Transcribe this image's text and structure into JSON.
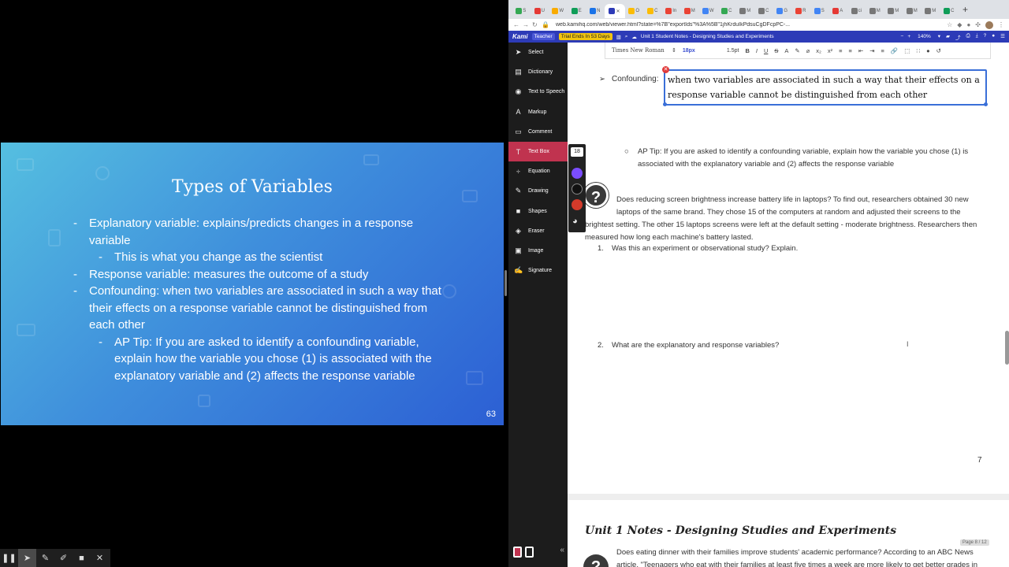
{
  "slide": {
    "title": "Types of Variables",
    "bullets": [
      {
        "level": 1,
        "text": "Explanatory variable: explains/predicts changes in a response variable"
      },
      {
        "level": 2,
        "text": "This is what you change as the scientist"
      },
      {
        "level": 1,
        "text": "Response variable: measures the outcome of a study"
      },
      {
        "level": 1,
        "text": "Confounding: when two variables are associated in such a way that their effects on a response variable cannot be distinguished from each other"
      },
      {
        "level": 2,
        "text": "AP Tip: If you are asked to identify a confounding variable, explain how the variable you chose (1) is associated with the explanatory variable and (2) affects the response variable"
      }
    ],
    "number": "63"
  },
  "browser": {
    "tabs": [
      "S",
      "U",
      "W",
      "E",
      "N",
      "",
      "O",
      "C",
      "In",
      "M",
      "W",
      "C",
      "M",
      "C",
      "G",
      "R",
      "S",
      "A",
      "ci",
      "M",
      "M",
      "M",
      "M",
      "C"
    ],
    "url": "web.kamihq.com/web/viewer.html?state=%7B\"exportIds\"%3A%5B\"1jhKrduIkPdsuCgDFcpPC-...",
    "kami": {
      "logo": "Kami",
      "teacher": "Teacher",
      "trial": "Trial Ends In 53 Days",
      "doc_title": "Unit 1 Student Notes - Designing Studies and Experiments",
      "zoom": "140%"
    }
  },
  "tools": [
    {
      "label": "Select",
      "icon": "cursor-icon",
      "glyph": "➤"
    },
    {
      "label": "Dictionary",
      "icon": "dictionary-icon",
      "glyph": "▤"
    },
    {
      "label": "Text to Speech",
      "icon": "speech-icon",
      "glyph": "◉"
    },
    {
      "label": "Markup",
      "icon": "markup-icon",
      "glyph": "A"
    },
    {
      "label": "Comment",
      "icon": "comment-icon",
      "glyph": "▭"
    },
    {
      "label": "Text Box",
      "icon": "textbox-icon",
      "glyph": "T"
    },
    {
      "label": "Equation",
      "icon": "equation-icon",
      "glyph": "÷"
    },
    {
      "label": "Drawing",
      "icon": "drawing-icon",
      "glyph": "✎"
    },
    {
      "label": "Shapes",
      "icon": "shapes-icon",
      "glyph": "■"
    },
    {
      "label": "Eraser",
      "icon": "eraser-icon",
      "glyph": "◈"
    },
    {
      "label": "Image",
      "icon": "image-icon",
      "glyph": "▣"
    },
    {
      "label": "Signature",
      "icon": "signature-icon",
      "glyph": "✍"
    }
  ],
  "palette": {
    "font_size": "18",
    "colors": [
      "#7b4dff",
      "#111111",
      "#d33a2a"
    ]
  },
  "format_bar": {
    "font_family": "Times New Roman",
    "font_size": "18px",
    "line_spacing": "1.5pt",
    "buttons": [
      "B",
      "I",
      "U",
      "S",
      "A",
      "✎",
      "⌀",
      "x₂",
      "x²",
      "≡",
      "≡",
      "⇤",
      "⇥",
      "≡",
      "🔗",
      "⬚",
      "∷",
      "●",
      "↺"
    ]
  },
  "document": {
    "confounding_label": "Confounding:",
    "confounding_text": "when two variables are associated in such a way that their effects on a response variable cannot be distinguished from each other",
    "ap_tip": "AP Tip: If you are asked to identify a confounding variable, explain how the variable you chose (1) is associated with the explanatory variable and (2) affects the response variable",
    "scenario_line1": "Does reducing screen brightness increase battery life in laptops? To find out, researchers obtained 30 new",
    "scenario_line2": "laptops of the same brand. They chose 15 of the computers at random and adjusted their screens to the",
    "scenario_line3": "brightest setting. The other 15 laptops screens were left at the default setting - moderate brightness. Researchers then",
    "scenario_line4": "measured how long each machine's battery lasted.",
    "q1_number": "1.",
    "q1": "Was this an experiment or observational study? Explain.",
    "q2_number": "2.",
    "q2": "What are the explanatory and response variables?",
    "page_number": "7",
    "next_heading": "Unit 1 Notes - Designing Studies and Experiments",
    "next_line1": "Does eating dinner with their families improve students' academic performance? According to an ABC News",
    "next_line2": "article, \"Teenagers who eat with their families at least five times a week are more likely to get better grades in",
    "page_indicator": "Page 8 / 12"
  }
}
